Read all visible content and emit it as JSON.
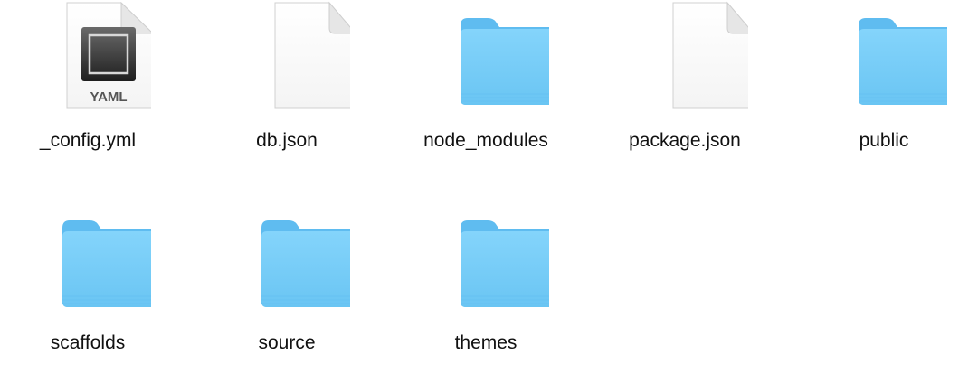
{
  "window": {
    "view": "icon-view"
  },
  "colors": {
    "folder_back": "#6bc6f5",
    "folder_front": "#7fd2fa",
    "doc_page": "#fbfbfb",
    "doc_fold": "#e4e4e4",
    "yaml_badge": "#2b2b2b"
  },
  "items": [
    {
      "name": "_config.yml",
      "kind": "yaml-file",
      "badge": "YAML"
    },
    {
      "name": "db.json",
      "kind": "document"
    },
    {
      "name": "node_modules",
      "kind": "folder"
    },
    {
      "name": "package.json",
      "kind": "document"
    },
    {
      "name": "public",
      "kind": "folder"
    },
    {
      "name": "scaffolds",
      "kind": "folder"
    },
    {
      "name": "source",
      "kind": "folder"
    },
    {
      "name": "themes",
      "kind": "folder"
    }
  ]
}
